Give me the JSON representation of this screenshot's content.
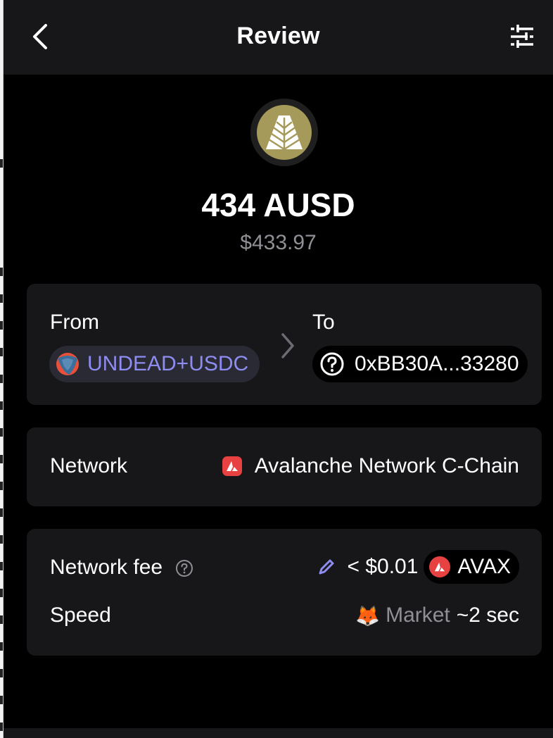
{
  "header": {
    "title": "Review",
    "back_icon": "chevron-left-icon",
    "settings_icon": "sliders-icon"
  },
  "token": {
    "icon": "ausd-token-icon",
    "amount": "434 AUSD",
    "usd_value": "$433.97"
  },
  "route": {
    "from_label": "From",
    "from_value": "UNDEAD+USDC",
    "to_label": "To",
    "to_value": "0xBB30A...33280"
  },
  "network": {
    "label": "Network",
    "value": "Avalanche Network C-Chain"
  },
  "fee": {
    "label": "Network fee",
    "amount": "< $0.01",
    "currency": "AVAX",
    "speed_label": "Speed",
    "speed_icon": "🦊",
    "speed_mode": "Market",
    "speed_time": "~2 sec"
  },
  "colors": {
    "accent": "#8e8cf0",
    "avalanche_red": "#e84142",
    "card_bg": "#17171a",
    "muted": "#8f8f95",
    "token_gold": "#a59a5a"
  }
}
